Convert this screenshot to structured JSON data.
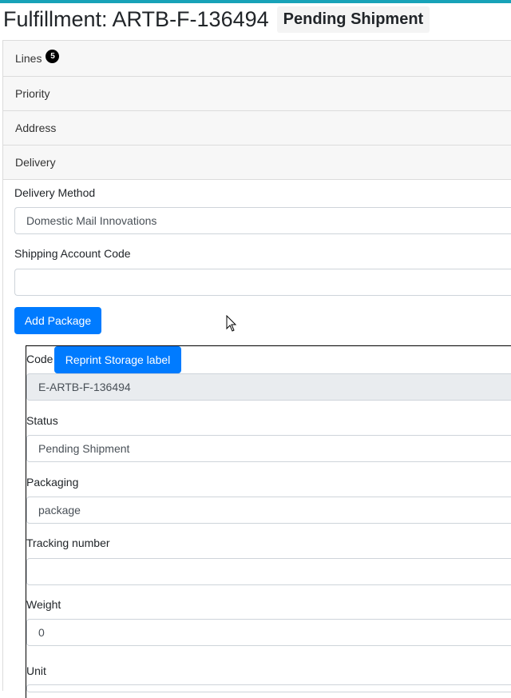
{
  "colors": {
    "accent": "#17a2b8",
    "primary": "#007bff",
    "badge": "#000000"
  },
  "header": {
    "title": "Fulfillment: ARTB-F-136494",
    "status": "Pending Shipment"
  },
  "accordion": {
    "lines_label": "Lines",
    "lines_count": "5",
    "priority_label": "Priority",
    "address_label": "Address",
    "delivery_label": "Delivery"
  },
  "delivery": {
    "method_label": "Delivery Method",
    "method_value": "Domestic Mail Innovations",
    "account_label": "Shipping Account Code",
    "account_value": "",
    "add_package_label": "Add Package"
  },
  "package": {
    "code_label": "Code",
    "reprint_label": "Reprint Storage label",
    "code_value": "E-ARTB-F-136494",
    "status_label": "Status",
    "status_value": "Pending Shipment",
    "packaging_label": "Packaging",
    "packaging_value": "package",
    "tracking_label": "Tracking number",
    "tracking_value": "",
    "weight_label": "Weight",
    "weight_value": "0",
    "unit_label": "Unit"
  },
  "icons": {
    "cursor": "mouse-pointer-icon"
  }
}
